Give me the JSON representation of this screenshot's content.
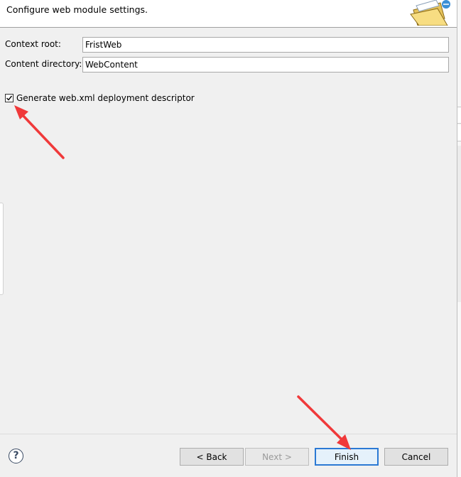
{
  "header": {
    "description": "Configure web module settings."
  },
  "form": {
    "context_root": {
      "label": "Context root:",
      "value": "FristWeb"
    },
    "content_directory": {
      "label": "Content directory:",
      "value": "WebContent"
    },
    "generate_descriptor": {
      "label": "Generate web.xml deployment descriptor",
      "checked": true
    }
  },
  "footer": {
    "back_label": "< Back",
    "next_label": "Next >",
    "finish_label": "Finish",
    "cancel_label": "Cancel",
    "help_glyph": "?"
  },
  "colors": {
    "annotation_arrow": "#f0393a",
    "default_button_border": "#2b79d4"
  },
  "icons": {
    "wizard_banner": "folder-icon",
    "help": "help-icon"
  }
}
